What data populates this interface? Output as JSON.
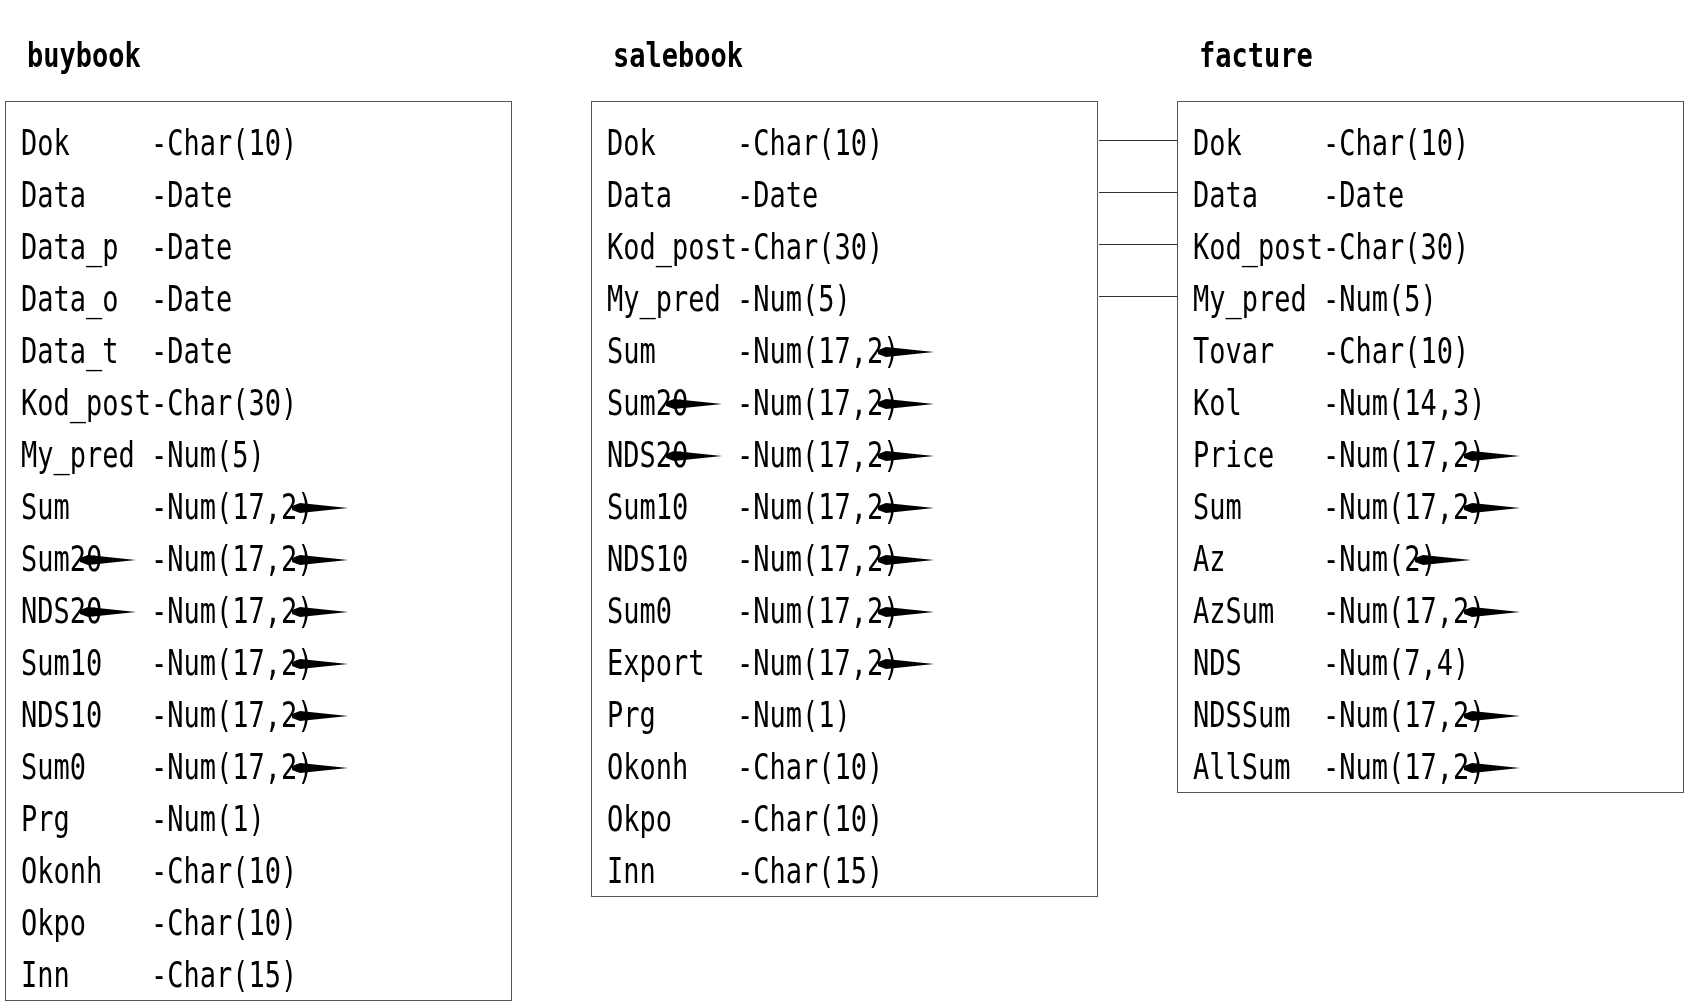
{
  "tables": [
    {
      "title": "buybook",
      "fields": [
        {
          "name": "Dok",
          "type": "-Char(10)",
          "name_mark": false,
          "type_mark": false,
          "linked": false
        },
        {
          "name": "Data",
          "type": "-Date",
          "name_mark": false,
          "type_mark": false,
          "linked": false
        },
        {
          "name": "Data_p",
          "type": "-Date",
          "name_mark": false,
          "type_mark": false,
          "linked": false
        },
        {
          "name": "Data_o",
          "type": "-Date",
          "name_mark": false,
          "type_mark": false,
          "linked": false
        },
        {
          "name": "Data_t",
          "type": "-Date",
          "name_mark": false,
          "type_mark": false,
          "linked": false
        },
        {
          "name": "Kod_post",
          "type": "-Char(30)",
          "name_mark": false,
          "type_mark": false,
          "linked": false
        },
        {
          "name": "My_pred",
          "type": "-Num(5)",
          "name_mark": false,
          "type_mark": false,
          "linked": false
        },
        {
          "name": "Sum",
          "type": "-Num(17,2)",
          "name_mark": false,
          "type_mark": true,
          "linked": false
        },
        {
          "name": "Sum20",
          "type": "-Num(17,2)",
          "name_mark": true,
          "type_mark": true,
          "linked": false
        },
        {
          "name": "NDS20",
          "type": "-Num(17,2)",
          "name_mark": true,
          "type_mark": true,
          "linked": false
        },
        {
          "name": "Sum10",
          "type": "-Num(17,2)",
          "name_mark": false,
          "type_mark": true,
          "linked": false
        },
        {
          "name": "NDS10",
          "type": "-Num(17,2)",
          "name_mark": false,
          "type_mark": true,
          "linked": false
        },
        {
          "name": "Sum0",
          "type": "-Num(17,2)",
          "name_mark": false,
          "type_mark": true,
          "linked": false
        },
        {
          "name": "Prg",
          "type": "-Num(1)",
          "name_mark": false,
          "type_mark": false,
          "linked": false
        },
        {
          "name": "Okonh",
          "type": "-Char(10)",
          "name_mark": false,
          "type_mark": false,
          "linked": false
        },
        {
          "name": "Okpo",
          "type": "-Char(10)",
          "name_mark": false,
          "type_mark": false,
          "linked": false
        },
        {
          "name": "Inn",
          "type": "-Char(15)",
          "name_mark": false,
          "type_mark": false,
          "linked": false
        }
      ]
    },
    {
      "title": "salebook",
      "fields": [
        {
          "name": "Dok",
          "type": "-Char(10)",
          "name_mark": false,
          "type_mark": false,
          "linked": true
        },
        {
          "name": "Data",
          "type": "-Date",
          "name_mark": false,
          "type_mark": false,
          "linked": true
        },
        {
          "name": "Kod_post",
          "type": "-Char(30)",
          "name_mark": false,
          "type_mark": false,
          "linked": true
        },
        {
          "name": "My_pred",
          "type": "-Num(5)",
          "name_mark": false,
          "type_mark": false,
          "linked": true
        },
        {
          "name": "Sum",
          "type": "-Num(17,2)",
          "name_mark": false,
          "type_mark": true,
          "linked": false
        },
        {
          "name": "Sum20",
          "type": "-Num(17,2)",
          "name_mark": true,
          "type_mark": true,
          "linked": false
        },
        {
          "name": "NDS20",
          "type": "-Num(17,2)",
          "name_mark": true,
          "type_mark": true,
          "linked": false
        },
        {
          "name": "Sum10",
          "type": "-Num(17,2)",
          "name_mark": false,
          "type_mark": true,
          "linked": false
        },
        {
          "name": "NDS10",
          "type": "-Num(17,2)",
          "name_mark": false,
          "type_mark": true,
          "linked": false
        },
        {
          "name": "Sum0",
          "type": "-Num(17,2)",
          "name_mark": false,
          "type_mark": true,
          "linked": false
        },
        {
          "name": "Export",
          "type": "-Num(17,2)",
          "name_mark": false,
          "type_mark": true,
          "linked": false
        },
        {
          "name": "Prg",
          "type": "-Num(1)",
          "name_mark": false,
          "type_mark": false,
          "linked": false
        },
        {
          "name": "Okonh",
          "type": "-Char(10)",
          "name_mark": false,
          "type_mark": false,
          "linked": false
        },
        {
          "name": "Okpo",
          "type": "-Char(10)",
          "name_mark": false,
          "type_mark": false,
          "linked": false
        },
        {
          "name": "Inn",
          "type": "-Char(15)",
          "name_mark": false,
          "type_mark": false,
          "linked": false
        }
      ]
    },
    {
      "title": "facture",
      "fields": [
        {
          "name": "Dok",
          "type": "-Char(10)",
          "name_mark": false,
          "type_mark": false,
          "linked": false
        },
        {
          "name": "Data",
          "type": "-Date",
          "name_mark": false,
          "type_mark": false,
          "linked": false
        },
        {
          "name": "Kod_post",
          "type": "-Char(30)",
          "name_mark": false,
          "type_mark": false,
          "linked": false
        },
        {
          "name": "My_pred",
          "type": "-Num(5)",
          "name_mark": false,
          "type_mark": false,
          "linked": false
        },
        {
          "name": "Tovar",
          "type": "-Char(10)",
          "name_mark": false,
          "type_mark": false,
          "linked": false
        },
        {
          "name": "Kol",
          "type": "-Num(14,3)",
          "name_mark": false,
          "type_mark": false,
          "linked": false
        },
        {
          "name": "Price",
          "type": "-Num(17,2)",
          "name_mark": false,
          "type_mark": true,
          "linked": false
        },
        {
          "name": "Sum",
          "type": "-Num(17,2)",
          "name_mark": false,
          "type_mark": true,
          "linked": false
        },
        {
          "name": "Az",
          "type": "-Num(2)",
          "name_mark": false,
          "type_mark": true,
          "linked": false
        },
        {
          "name": "AzSum",
          "type": "-Num(17,2)",
          "name_mark": false,
          "type_mark": true,
          "linked": false
        },
        {
          "name": "NDS",
          "type": "-Num(7,4)",
          "name_mark": false,
          "type_mark": false,
          "linked": false
        },
        {
          "name": "NDSSum",
          "type": "-Num(17,2)",
          "name_mark": false,
          "type_mark": true,
          "linked": false
        },
        {
          "name": "AllSum",
          "type": "-Num(17,2)",
          "name_mark": false,
          "type_mark": true,
          "linked": false
        }
      ]
    }
  ]
}
